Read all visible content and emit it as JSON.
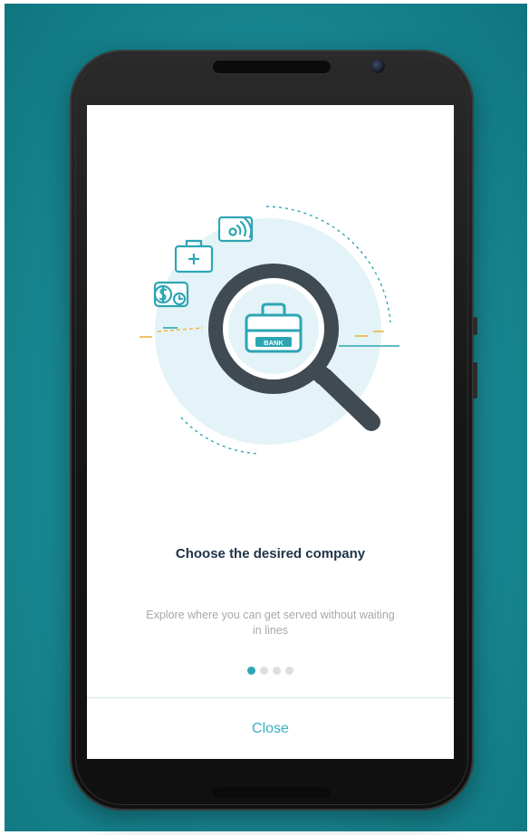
{
  "onboarding": {
    "title": "Choose the desired company",
    "description": "Explore where you can get served without waiting in lines",
    "illustration_label": "BANK",
    "page_indicator": {
      "total": 4,
      "current": 1
    },
    "close_label": "Close"
  },
  "colors": {
    "background": "#1b8d97",
    "accent": "#2da6b4",
    "title_text": "#1f3347",
    "body_text": "#a5a9ad",
    "magnifier": "#3f4a52",
    "highlight_yellow": "#f0b33a"
  },
  "icons": [
    "money-bill-icon",
    "medical-kit-icon",
    "satellite-card-icon",
    "briefcase-icon",
    "magnifier-icon"
  ]
}
